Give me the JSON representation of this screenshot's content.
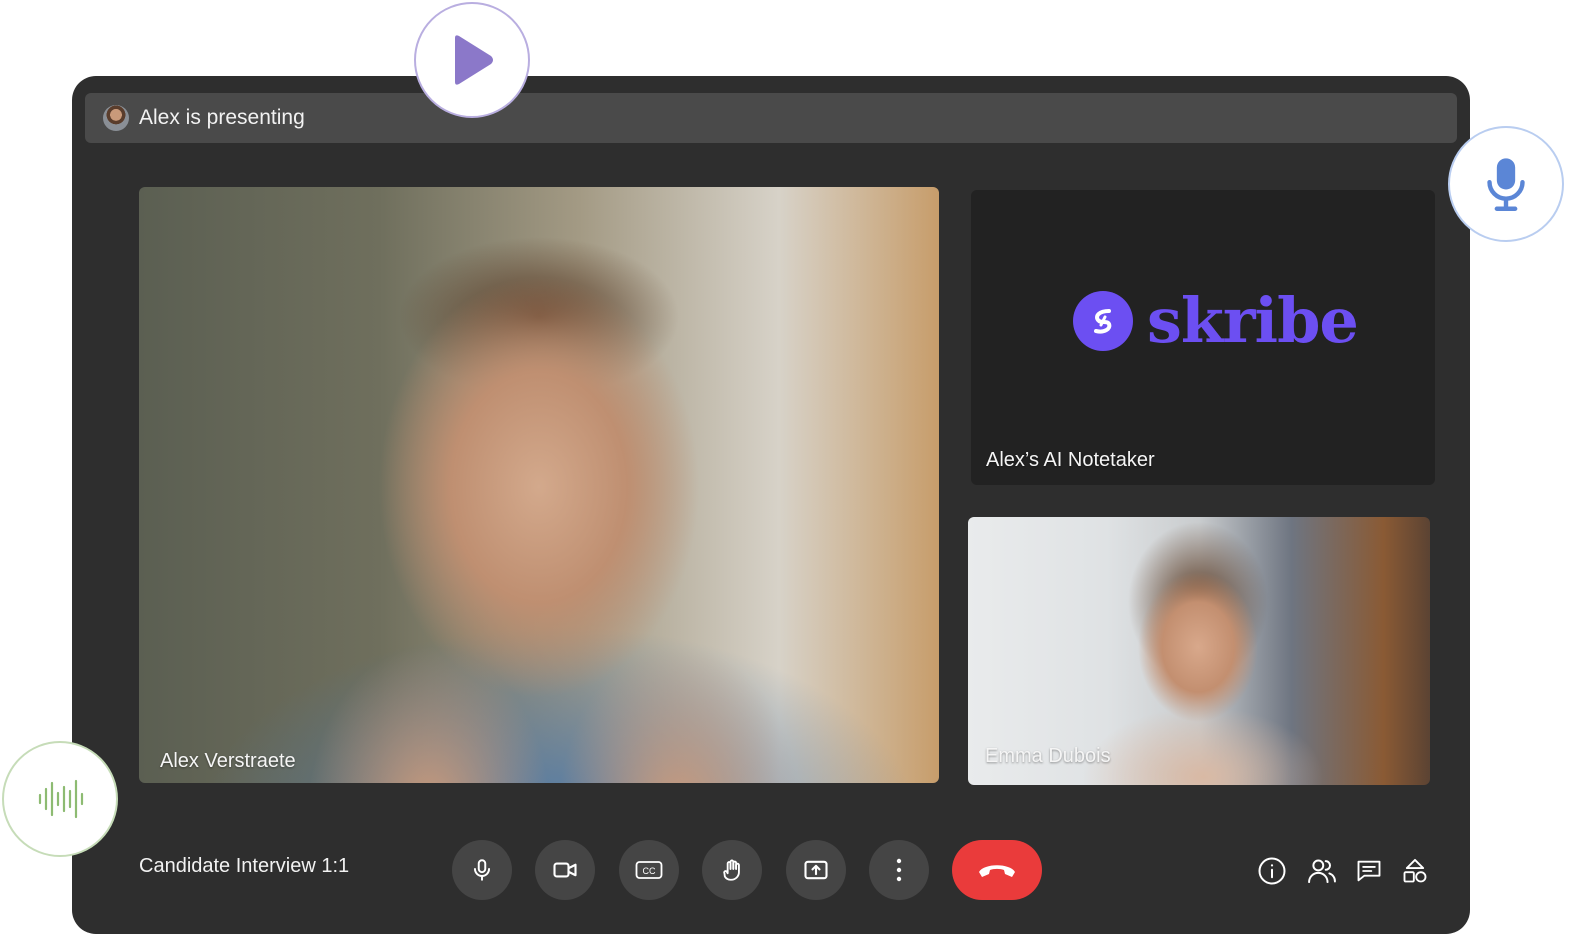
{
  "presentation_bar": {
    "text": "Alex is presenting",
    "avatar_icon": "presenter-avatar"
  },
  "participants": [
    {
      "name": "Alex Verstraete"
    },
    {
      "name": "Alex’s AI Notetaker",
      "brand_name": "skribe",
      "brand_color": "#6c4ff2"
    },
    {
      "name": "Emma Dubois"
    }
  ],
  "meeting": {
    "title": "Candidate Interview 1:1"
  },
  "controls": [
    {
      "icon": "microphone-icon"
    },
    {
      "icon": "camera-icon"
    },
    {
      "icon": "captions-icon"
    },
    {
      "icon": "raise-hand-icon"
    },
    {
      "icon": "present-screen-icon"
    },
    {
      "icon": "more-options-icon"
    },
    {
      "icon": "hang-up-icon",
      "color": "#ea3b3b"
    }
  ],
  "utility_icons": [
    "info-icon",
    "people-icon",
    "chat-icon",
    "activities-icon"
  ],
  "badges": [
    {
      "icon": "play-icon",
      "color": "#8b78c9"
    },
    {
      "icon": "microphone-icon",
      "color": "#5b86d6"
    },
    {
      "icon": "audio-waveform-icon",
      "color": "#8dbb72"
    }
  ]
}
